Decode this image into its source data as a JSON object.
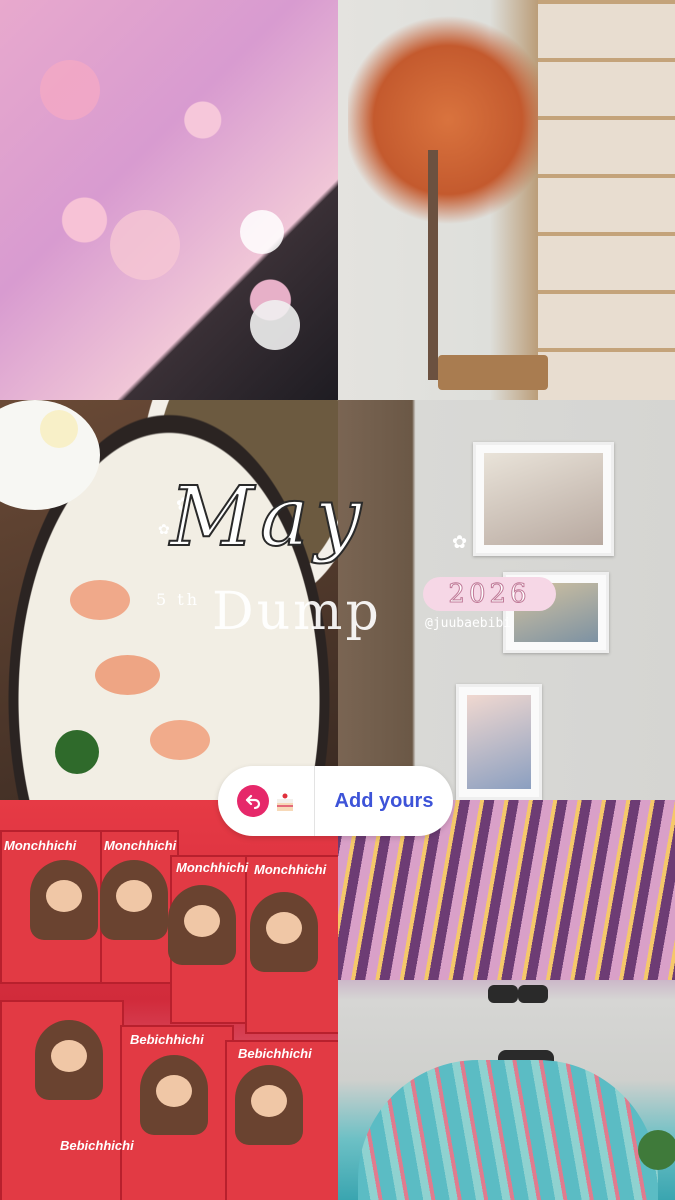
{
  "story": {
    "title_main": "May",
    "day": "5 th",
    "subtitle": "Dump",
    "year": "2026",
    "handle": "@juubaebibi"
  },
  "sticker": {
    "add_yours_label": "Add yours"
  },
  "colors": {
    "add_yours_text": "#3d53d8",
    "reply_icon_bg": "#e6286a",
    "year_pill_bg": "#f6d7e6"
  },
  "photos": {
    "box_labels": [
      "Monchhichi",
      "Monchhichi",
      "Monchhichi",
      "Monchhichi",
      "Bebichhichi",
      "Bebichhichi",
      "Bebichhichi"
    ]
  }
}
